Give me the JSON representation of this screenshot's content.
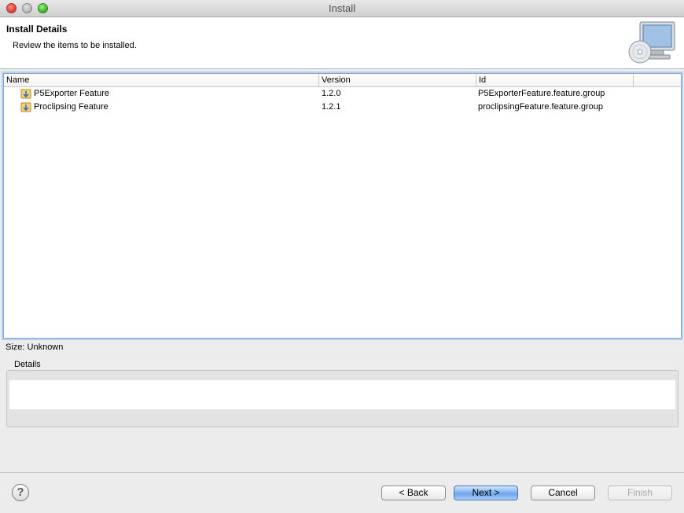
{
  "window": {
    "title": "Install"
  },
  "banner": {
    "title": "Install Details",
    "description": "Review the items to be installed."
  },
  "table": {
    "columns": [
      "Name",
      "Version",
      "Id"
    ],
    "rows": [
      {
        "name": "P5Exporter Feature",
        "version": "1.2.0",
        "id": "P5ExporterFeature.feature.group"
      },
      {
        "name": "Proclipsing Feature",
        "version": "1.2.1",
        "id": "proclipsingFeature.feature.group"
      }
    ]
  },
  "size_text": "Size: Unknown",
  "details": {
    "label": "Details",
    "value": ""
  },
  "buttons": {
    "help": "?",
    "back": "< Back",
    "next": "Next >",
    "cancel": "Cancel",
    "finish": "Finish"
  },
  "colors": {
    "selection_border": "#7aa7d8",
    "primary_button": "#7eb0ef"
  },
  "icons": [
    "install-wizard-icon",
    "feature-icon",
    "help-icon"
  ]
}
